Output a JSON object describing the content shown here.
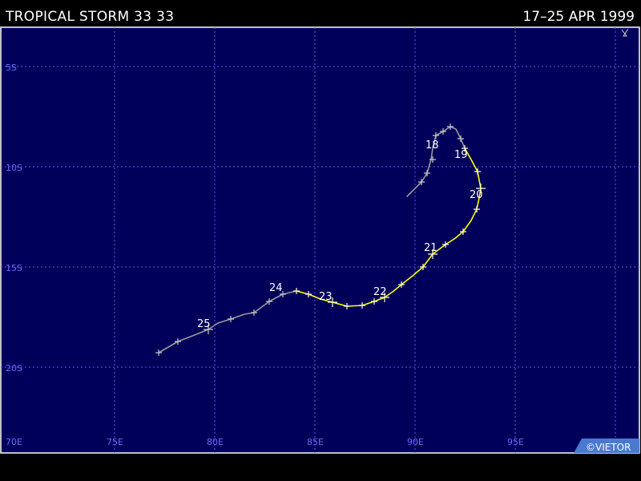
{
  "header": {
    "title": "TROPICAL STORM 33 33",
    "dates": "17–25 APR 1999"
  },
  "map": {
    "background": "#00005a",
    "border": "#ffffff",
    "grid_color": "#5a5aff",
    "label_color": "#6a6aff",
    "lon_labels": [
      "70E",
      "75E",
      "80E",
      "85E",
      "90E",
      "95E"
    ],
    "lat_labels": [
      "5S",
      "10S",
      "15S",
      "20S"
    ],
    "credit": "©VIETOR",
    "credit_bg": "#4a7ad0"
  },
  "track": {
    "colors": {
      "weak": "#9a9a9a",
      "storm": "#ffff00"
    },
    "day_labels": [
      "18",
      "19",
      "20",
      "21",
      "22",
      "23",
      "24",
      "25"
    ]
  }
}
